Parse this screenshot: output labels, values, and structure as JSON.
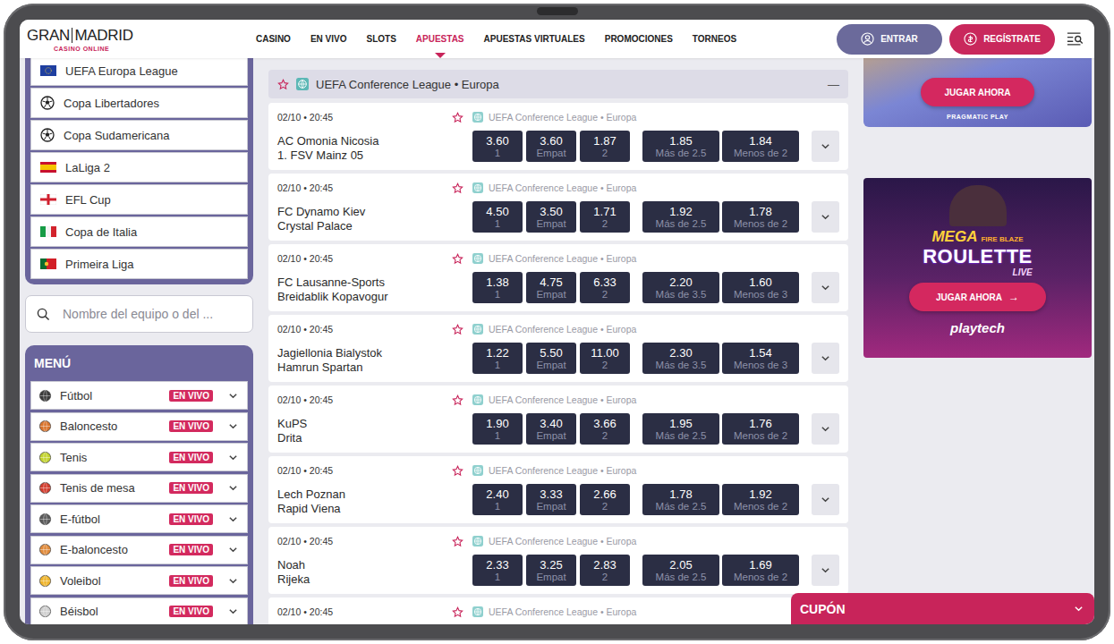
{
  "header": {
    "logo": {
      "left": "GRAN",
      "right": "MADRID",
      "tagline": "CASINO ONLINE"
    },
    "nav": [
      {
        "label": "CASINO",
        "selected": false
      },
      {
        "label": "EN VIVO",
        "selected": false
      },
      {
        "label": "SLOTS",
        "selected": false
      },
      {
        "label": "APUESTAS",
        "selected": true
      },
      {
        "label": "APUESTAS VIRTUALES",
        "selected": false
      },
      {
        "label": "PROMOCIONES",
        "selected": false
      },
      {
        "label": "TORNEOS",
        "selected": false
      }
    ],
    "buttons": [
      {
        "label": "ENTRAR",
        "kind": "login"
      },
      {
        "label": "REGÍSTRATE",
        "kind": "register"
      }
    ]
  },
  "sidebar": {
    "leagues": [
      {
        "name": "UEFA Europa League",
        "kind": "eu"
      },
      {
        "name": "Copa Libertadores",
        "kind": "ball"
      },
      {
        "name": "Copa Sudamericana",
        "kind": "ball"
      },
      {
        "name": "LaLiga 2",
        "kind": "es"
      },
      {
        "name": "EFL Cup",
        "kind": "en"
      },
      {
        "name": "Copa de Italia",
        "kind": "it"
      },
      {
        "name": "Primeira Liga",
        "kind": "pt"
      }
    ],
    "search": {
      "placeholder": "Nombre del equipo o del ..."
    },
    "menu": {
      "title": "MENÚ",
      "items": [
        {
          "name": "Fútbol",
          "badge": "EN VIVO",
          "kind": "soccer",
          "expanded": false
        },
        {
          "name": "Baloncesto",
          "badge": "EN VIVO",
          "kind": "basketball",
          "expanded": false
        },
        {
          "name": "Tenis",
          "badge": "EN VIVO",
          "kind": "tennis",
          "expanded": false
        },
        {
          "name": "Tenis de mesa",
          "badge": "EN VIVO",
          "kind": "tabletennis",
          "expanded": false
        },
        {
          "name": "E-fútbol",
          "badge": "EN VIVO",
          "kind": "esoccer",
          "expanded": false
        },
        {
          "name": "E-baloncesto",
          "badge": "EN VIVO",
          "kind": "ebasketball",
          "expanded": false
        },
        {
          "name": "Voleibol",
          "badge": "EN VIVO",
          "kind": "volleyball",
          "expanded": false
        },
        {
          "name": "Béisbol",
          "badge": "EN VIVO",
          "kind": "baseball",
          "expanded": false
        }
      ]
    }
  },
  "events": {
    "group": {
      "title": "UEFA Conference League • Europa",
      "collapse": "—",
      "favorite": false,
      "expanded": true
    },
    "matches": [
      {
        "time": "02/10 • 20:45",
        "league": "UEFA Conference League • Europa",
        "home": "AC Omonia Nicosia",
        "away": "1. FSV Mainz 05",
        "favorite": false,
        "odds": [
          {
            "value": "3.60",
            "label": "1",
            "kind": "result"
          },
          {
            "value": "3.60",
            "label": "Empat",
            "kind": "result"
          },
          {
            "value": "1.87",
            "label": "2",
            "kind": "result"
          },
          {
            "value": "1.85",
            "label": "Más de 2.5",
            "kind": "total"
          },
          {
            "value": "1.84",
            "label": "Menos de 2",
            "kind": "total"
          }
        ]
      },
      {
        "time": "02/10 • 20:45",
        "league": "UEFA Conference League • Europa",
        "home": "FC Dynamo Kiev",
        "away": "Crystal Palace",
        "favorite": false,
        "odds": [
          {
            "value": "4.50",
            "label": "1",
            "kind": "result"
          },
          {
            "value": "3.50",
            "label": "Empat",
            "kind": "result"
          },
          {
            "value": "1.71",
            "label": "2",
            "kind": "result"
          },
          {
            "value": "1.92",
            "label": "Más de 2.5",
            "kind": "total"
          },
          {
            "value": "1.78",
            "label": "Menos de 2",
            "kind": "total"
          }
        ]
      },
      {
        "time": "02/10 • 20:45",
        "league": "UEFA Conference League • Europa",
        "home": "FC Lausanne-Sports",
        "away": "Breidablik Kopavogur",
        "favorite": false,
        "odds": [
          {
            "value": "1.38",
            "label": "1",
            "kind": "result"
          },
          {
            "value": "4.75",
            "label": "Empat",
            "kind": "result"
          },
          {
            "value": "6.33",
            "label": "2",
            "kind": "result"
          },
          {
            "value": "2.20",
            "label": "Más de 3.5",
            "kind": "total"
          },
          {
            "value": "1.60",
            "label": "Menos de 3",
            "kind": "total"
          }
        ]
      },
      {
        "time": "02/10 • 20:45",
        "league": "UEFA Conference League • Europa",
        "home": "Jagiellonia Bialystok",
        "away": "Hamrun Spartan",
        "favorite": false,
        "odds": [
          {
            "value": "1.22",
            "label": "1",
            "kind": "result"
          },
          {
            "value": "5.50",
            "label": "Empat",
            "kind": "result"
          },
          {
            "value": "11.00",
            "label": "2",
            "kind": "result"
          },
          {
            "value": "2.30",
            "label": "Más de 3.5",
            "kind": "total"
          },
          {
            "value": "1.54",
            "label": "Menos de 3",
            "kind": "total"
          }
        ]
      },
      {
        "time": "02/10 • 20:45",
        "league": "UEFA Conference League • Europa",
        "home": "KuPS",
        "away": "Drita",
        "favorite": false,
        "odds": [
          {
            "value": "1.90",
            "label": "1",
            "kind": "result"
          },
          {
            "value": "3.40",
            "label": "Empat",
            "kind": "result"
          },
          {
            "value": "3.66",
            "label": "2",
            "kind": "result"
          },
          {
            "value": "1.95",
            "label": "Más de 2.5",
            "kind": "total"
          },
          {
            "value": "1.76",
            "label": "Menos de 2",
            "kind": "total"
          }
        ]
      },
      {
        "time": "02/10 • 20:45",
        "league": "UEFA Conference League • Europa",
        "home": "Lech Poznan",
        "away": "Rapid Viena",
        "favorite": false,
        "odds": [
          {
            "value": "2.40",
            "label": "1",
            "kind": "result"
          },
          {
            "value": "3.33",
            "label": "Empat",
            "kind": "result"
          },
          {
            "value": "2.66",
            "label": "2",
            "kind": "result"
          },
          {
            "value": "1.78",
            "label": "Más de 2.5",
            "kind": "total"
          },
          {
            "value": "1.92",
            "label": "Menos de 2",
            "kind": "total"
          }
        ]
      },
      {
        "time": "02/10 • 20:45",
        "league": "UEFA Conference League • Europa",
        "home": "Noah",
        "away": "Rijeka",
        "favorite": false,
        "odds": [
          {
            "value": "2.33",
            "label": "1",
            "kind": "result"
          },
          {
            "value": "3.25",
            "label": "Empat",
            "kind": "result"
          },
          {
            "value": "2.83",
            "label": "2",
            "kind": "result"
          },
          {
            "value": "2.05",
            "label": "Más de 2.5",
            "kind": "total"
          },
          {
            "value": "1.69",
            "label": "Menos de 2",
            "kind": "total"
          }
        ]
      },
      {
        "time": "02/10 • 20:45",
        "league": "UEFA Conference League • Europa",
        "home": "",
        "away": "",
        "favorite": false,
        "odds": []
      }
    ]
  },
  "promos": {
    "top": {
      "button": "JUGAR AHORA",
      "provider": "PRAGMATIC PLAY"
    },
    "roulette": {
      "title": [
        "MEGA",
        "FIRE BLAZE",
        "ROULETTE",
        "LIVE"
      ],
      "button": "JUGAR AHORA",
      "arrow": "→",
      "provider": "playtech"
    }
  },
  "coupon": {
    "label": "CUPÓN",
    "expanded": false
  }
}
